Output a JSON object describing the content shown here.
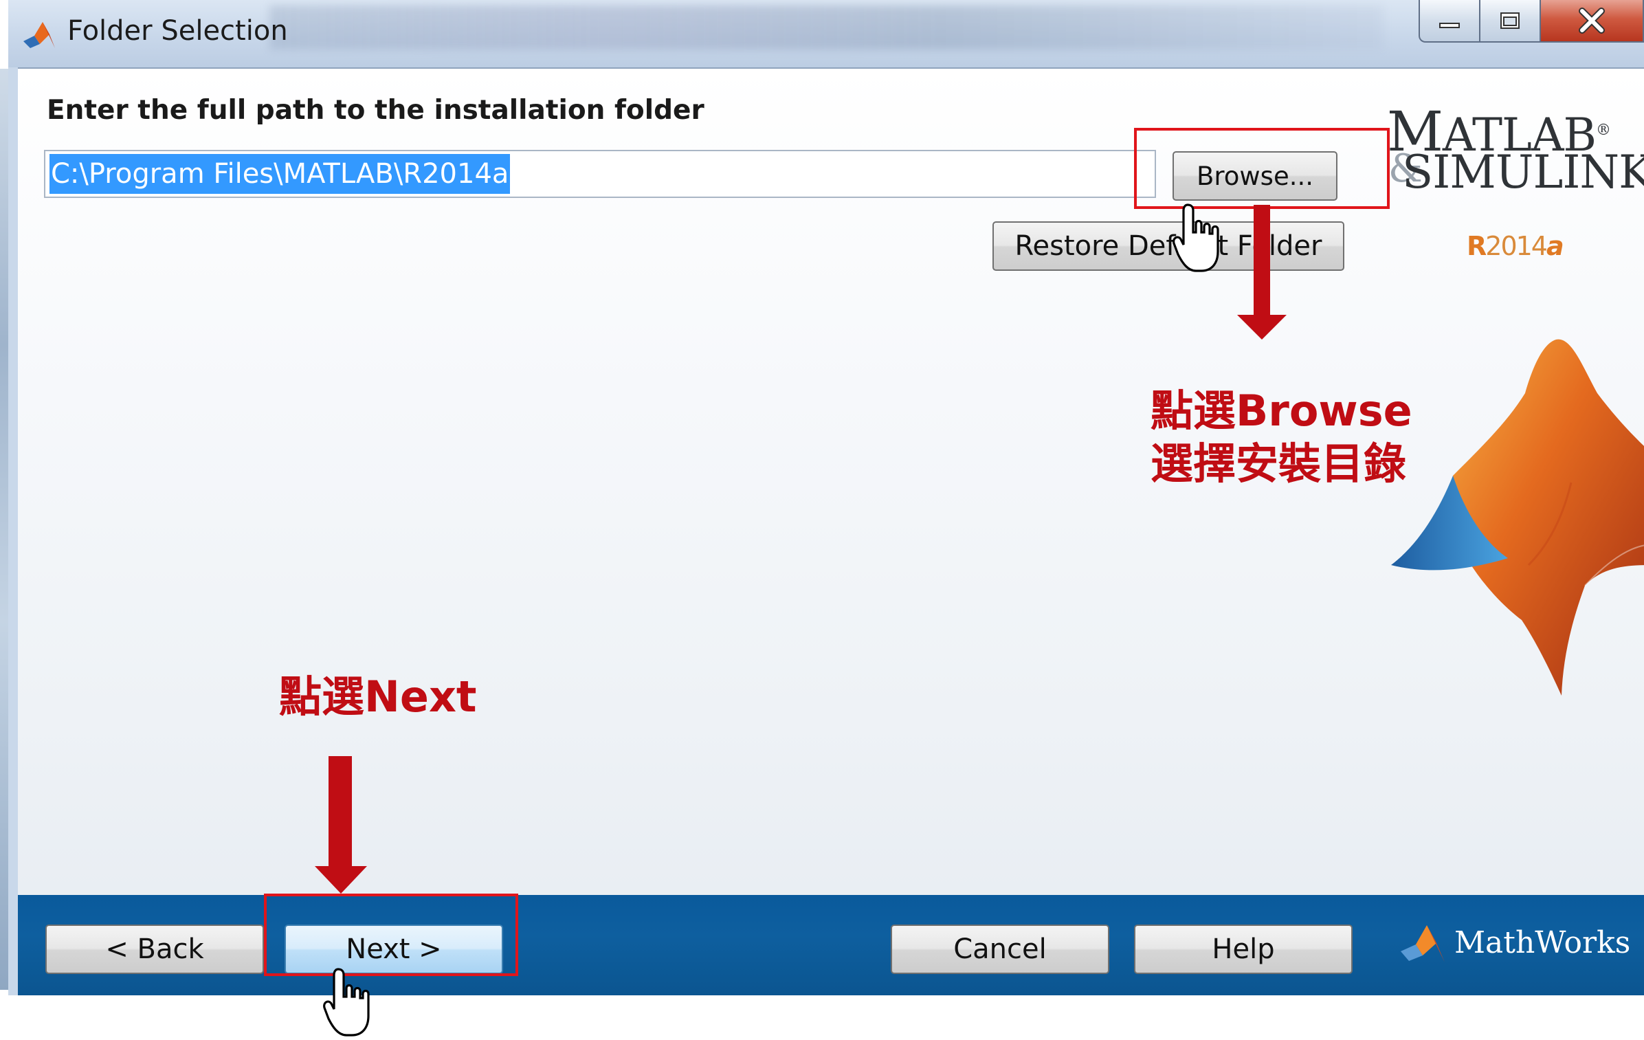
{
  "window": {
    "title": "Folder Selection"
  },
  "main": {
    "instruction": "Enter the full path to the installation folder",
    "path_value": "C:\\Program Files\\MATLAB\\R2014a",
    "browse_label": "Browse...",
    "restore_label": "Restore Default Folder"
  },
  "logo": {
    "matlab_first": "M",
    "matlab_rest": "ATLAB",
    "registered": "®",
    "simulink": "SIMULINK",
    "ampersand": "&",
    "release_r": "R",
    "release_num": "2014",
    "release_suffix": "a"
  },
  "footer": {
    "back_label": "< Back",
    "next_label": "Next >",
    "cancel_label": "Cancel",
    "help_label": "Help",
    "brand": "MathWorks"
  },
  "annotations": {
    "browse_note_line1": "點選Browse",
    "browse_note_line2": "選擇安裝目錄",
    "next_note": "點選Next"
  },
  "colors": {
    "annotation_red": "#c00d14",
    "footer_blue": "#0e5f9f",
    "selection_blue": "#3399ff",
    "release_orange": "#e07a24"
  },
  "icons": [
    "matlab-app-icon",
    "minimize-icon",
    "maximize-icon",
    "close-icon",
    "matlab-membrane-logo",
    "mathworks-logo-icon",
    "hand-pointer-cursor-icon"
  ]
}
